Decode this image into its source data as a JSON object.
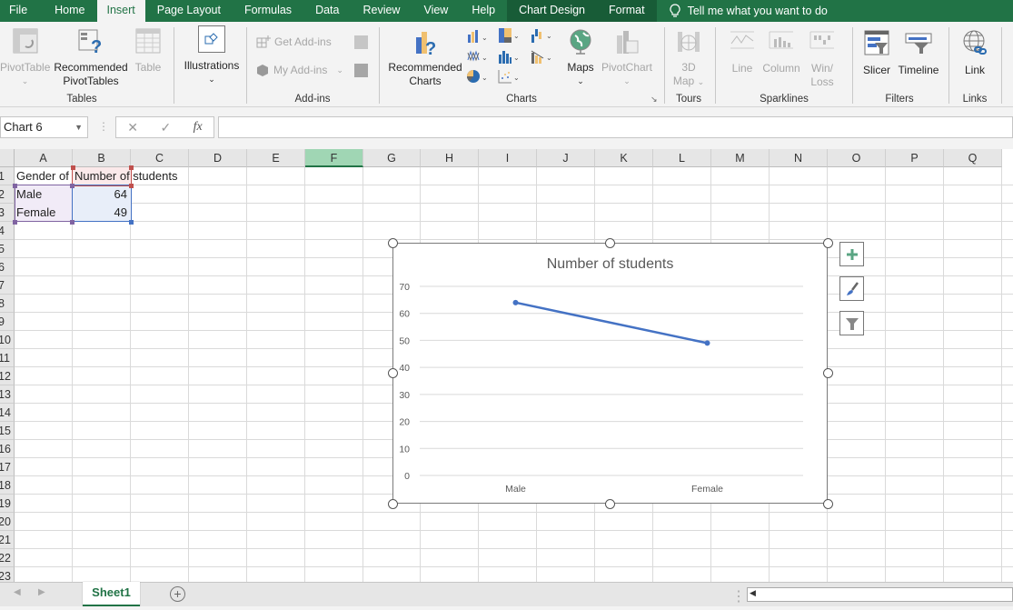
{
  "ribbon_tabs": [
    {
      "label": "File"
    },
    {
      "label": "Home"
    },
    {
      "label": "Insert",
      "active": true
    },
    {
      "label": "Page Layout"
    },
    {
      "label": "Formulas"
    },
    {
      "label": "Data"
    },
    {
      "label": "Review"
    },
    {
      "label": "View"
    },
    {
      "label": "Help"
    }
  ],
  "contextual_tabs": [
    {
      "label": "Chart Design"
    },
    {
      "label": "Format"
    }
  ],
  "tell_me": "Tell me what you want to do",
  "groups": {
    "tables": {
      "label": "Tables",
      "pivottable": "PivotTable",
      "recommended_pivottables_1": "Recommended",
      "recommended_pivottables_2": "PivotTables",
      "table": "Table"
    },
    "illustrations": {
      "label": "Illustrations"
    },
    "addins": {
      "label": "Add-ins",
      "get_addins": "Get Add-ins",
      "my_addins": "My Add-ins"
    },
    "charts": {
      "label": "Charts",
      "recommended_charts_1": "Recommended",
      "recommended_charts_2": "Charts",
      "maps": "Maps",
      "pivotchart": "PivotChart"
    },
    "tours": {
      "label": "Tours",
      "map3d_1": "3D",
      "map3d_2": "Map"
    },
    "sparklines": {
      "label": "Sparklines",
      "line": "Line",
      "column": "Column",
      "winloss_1": "Win/",
      "winloss_2": "Loss"
    },
    "filters": {
      "label": "Filters",
      "slicer": "Slicer",
      "timeline": "Timeline"
    },
    "links": {
      "label": "Links",
      "link": "Link"
    }
  },
  "formula_bar": {
    "name_box": "Chart 6",
    "formula": "",
    "fx": "fx"
  },
  "columns": [
    "A",
    "B",
    "C",
    "D",
    "E",
    "F",
    "G",
    "H",
    "I",
    "J",
    "K",
    "L",
    "M",
    "N",
    "O",
    "P",
    "Q"
  ],
  "selected_column": "F",
  "rows": [
    "1",
    "2",
    "3",
    "4",
    "5",
    "6",
    "7",
    "8",
    "9",
    "10",
    "11",
    "12",
    "13",
    "14",
    "15",
    "16",
    "17",
    "18",
    "19",
    "20",
    "21",
    "22",
    "23"
  ],
  "cells": {
    "A1": "Gender of",
    "B1": "Number of students",
    "A2": "Male",
    "B2": "64",
    "A3": "Female",
    "B3": "49"
  },
  "chart_data": {
    "type": "line",
    "title": "Number of students",
    "categories": [
      "Male",
      "Female"
    ],
    "series": [
      {
        "name": "Number of students",
        "values": [
          64,
          49
        ],
        "color": "#4472c4"
      }
    ],
    "ylim": [
      0,
      70
    ],
    "yticks": [
      "0",
      "10",
      "20",
      "30",
      "40",
      "50",
      "60",
      "70"
    ],
    "xlabel": "",
    "ylabel": "",
    "grid": true,
    "legend": "none"
  },
  "chart_side_buttons": [
    "chart-elements",
    "chart-styles",
    "chart-filters"
  ],
  "sheets": [
    {
      "label": "Sheet1",
      "active": true
    }
  ],
  "colors": {
    "accent": "#217346",
    "series": "#4472c4"
  }
}
